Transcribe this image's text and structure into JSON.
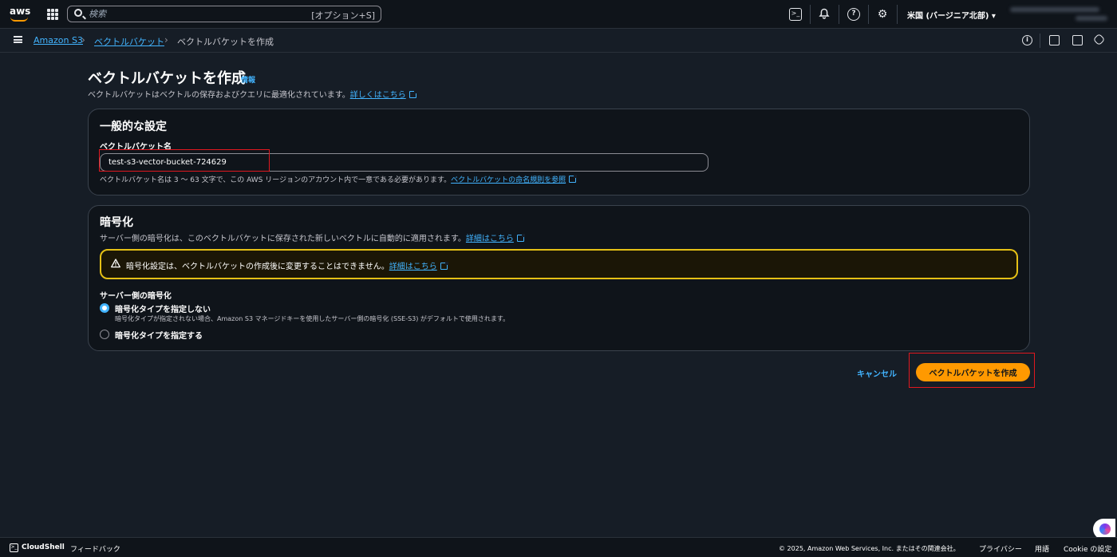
{
  "topbar": {
    "logo_text": "aws",
    "search_placeholder": "検索",
    "search_shortcut": "[オプション+S]",
    "region": "米国 (バージニア北部) ▾",
    "icons": [
      "cloudshell-icon",
      "bell-icon",
      "help-icon",
      "gear-icon"
    ]
  },
  "breadcrumb": {
    "items": [
      {
        "label": "Amazon S3"
      },
      {
        "label": "ベクトルバケット"
      },
      {
        "label": "ベクトルバケットを作成"
      }
    ]
  },
  "page": {
    "title": "ベクトルバケットを作成",
    "info_link": "情報",
    "description": "ベクトルバケットはベクトルの保存およびクエリに最適化されています。",
    "learn_more": "詳しくはこちら"
  },
  "general": {
    "title": "一般的な設定",
    "name_label": "ベクトルバケット名",
    "name_value": "test-s3-vector-bucket-724629",
    "hint": "ベクトルバケット名は 3 ～ 63 文字で、この AWS リージョンのアカウント内で一意である必要があります。",
    "hint_link": "ベクトルバケットの命名規則を参照"
  },
  "encryption": {
    "title": "暗号化",
    "description": "サーバー側の暗号化は、このベクトルバケットに保存された新しいベクトルに自動的に適用されます。",
    "description_link": "詳細はこちら",
    "alert_text": "暗号化設定は、ベクトルバケットの作成後に変更することはできません。",
    "alert_link": "詳細はこちら",
    "section_label": "サーバー側の暗号化",
    "option1_label": "暗号化タイプを指定しない",
    "option1_desc": "暗号化タイプが指定されない場合、Amazon S3 マネージドキーを使用したサーバー側の暗号化 (SSE-S3) がデフォルトで使用されます。",
    "option2_label": "暗号化タイプを指定する",
    "selected": "option1"
  },
  "actions": {
    "cancel": "キャンセル",
    "create": "ベクトルバケットを作成"
  },
  "footer": {
    "cloudshell": "CloudShell",
    "feedback": "フィードバック",
    "copyright": "© 2025, Amazon Web Services, Inc. またはその関連会社。",
    "privacy": "プライバシー",
    "terms": "用語",
    "cookie": "Cookie の設定"
  },
  "colors": {
    "accent_link": "#42b4ff",
    "primary_button": "#ff9900",
    "alert_border": "#e5c015",
    "highlight_box": "#e0181f"
  }
}
